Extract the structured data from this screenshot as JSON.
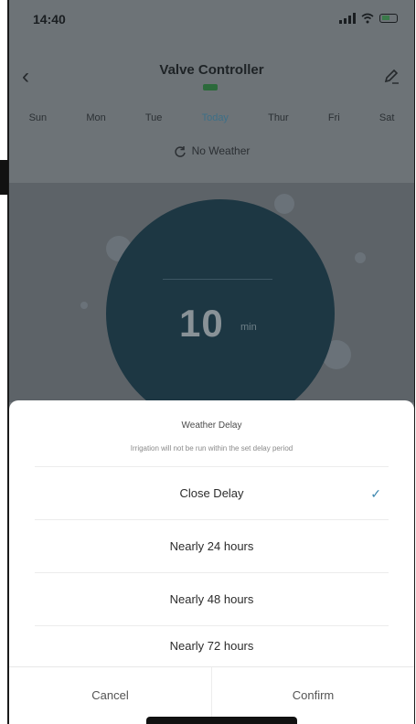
{
  "status_bar": {
    "time": "14:40"
  },
  "header": {
    "title": "Valve Controller",
    "subtitle": "",
    "back_icon": "chevron-left-icon",
    "edit_icon": "pencil-icon"
  },
  "days": [
    "Sun",
    "Mon",
    "Tue",
    "Today",
    "Thur",
    "Fri",
    "Sat"
  ],
  "weather": {
    "label": "No Weather"
  },
  "gauge": {
    "value": "10",
    "unit": "min"
  },
  "sheet": {
    "title": "Weather Delay",
    "description": "Irrigation will not be run within the set delay period",
    "options": [
      {
        "label": "Close Delay",
        "selected": true
      },
      {
        "label": "Nearly 24 hours",
        "selected": false
      },
      {
        "label": "Nearly 48 hours",
        "selected": false
      },
      {
        "label": "Nearly 72 hours",
        "selected": false
      }
    ],
    "cancel": "Cancel",
    "confirm": "Confirm"
  },
  "colors": {
    "accent": "#3f88b0",
    "gauge": "#1d3743",
    "overlay": "#6d7377"
  }
}
